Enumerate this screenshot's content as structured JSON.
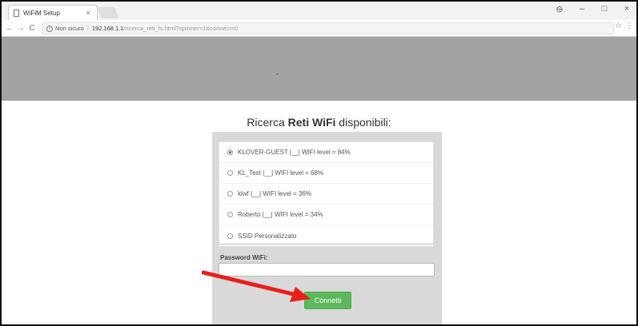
{
  "browser": {
    "tab_title": "WiFiM Setup",
    "tab_close": "×",
    "window_controls": [
      "⊖",
      "–",
      "□",
      "×"
    ],
    "nav": {
      "back": "←",
      "forward": "→",
      "reload": "C"
    },
    "address": {
      "security_label": "Non sicuro",
      "url_host": "192.168.1.1",
      "url_path": "/ricerca_reti_fs.html?spinner=1&connect=0"
    },
    "icons": [
      "info-icon",
      "star-icon",
      "menu-icon",
      "document-icon"
    ]
  },
  "page": {
    "header_band_color": "#a3a3a3",
    "title_prefix": "Ricerca ",
    "title_bold": "Reti WiFi",
    "title_suffix": " disponibili:",
    "networks": [
      {
        "label": "KLOVER-GUEST |__| WIFI level = 84%",
        "selected": true
      },
      {
        "label": "KL_Test |__| WIFI level = 68%",
        "selected": false
      },
      {
        "label": "klwf |__| WIFI level = 36%",
        "selected": false
      },
      {
        "label": "Roberto |__| WIFI level = 34%",
        "selected": false
      },
      {
        "label": "SSID Personalizzato",
        "selected": false
      }
    ],
    "password_label": "Password WiFi:",
    "password_value": "",
    "connect_label": "Connetti",
    "accent_color": "#5cb85c",
    "annotation_arrow_color": "#e8201a"
  }
}
